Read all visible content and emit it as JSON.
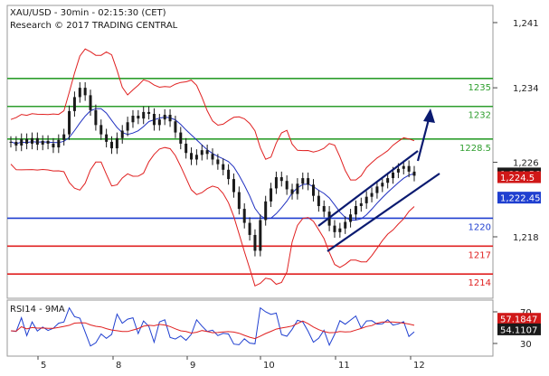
{
  "header": {
    "title": "XAU/USD - 30min - 02:15:30 (CET)",
    "source": "Research © 2017 TRADING CENTRAL"
  },
  "chart_data": {
    "type": "candlestick",
    "symbol": "XAU/USD",
    "timeframe": "30min",
    "price_ticks": [
      "1,241",
      "1,234",
      "1,226",
      "1,218"
    ],
    "price_tick_values": [
      1241,
      1234,
      1226,
      1218
    ],
    "x_ticks": [
      "5",
      "8",
      "9",
      "10",
      "11",
      "12"
    ],
    "levels": [
      {
        "label": "1235",
        "value": 1235,
        "color": "#2e9e2e"
      },
      {
        "label": "1232",
        "value": 1232,
        "color": "#2e9e2e"
      },
      {
        "label": "1228.5",
        "value": 1228.5,
        "color": "#2e9e2e"
      },
      {
        "label": "1220",
        "value": 1220,
        "color": "#1f3fd0"
      },
      {
        "label": "1217",
        "value": 1217,
        "color": "#e02020"
      },
      {
        "label": "1214",
        "value": 1214,
        "color": "#e02020"
      }
    ],
    "price_tags": [
      {
        "label": "1,224.56",
        "value": 1224.56,
        "color": "#1a1a1a"
      },
      {
        "label": "1,224.5",
        "value": 1224.5,
        "color": "#d01818"
      },
      {
        "label": "1,222.45",
        "value": 1222.45,
        "color": "#1f3fd0"
      }
    ],
    "close_series": [
      1228.2,
      1227.8,
      1228.5,
      1228.0,
      1228.6,
      1227.9,
      1228.3,
      1228.0,
      1227.6,
      1228.4,
      1229.0,
      1231.5,
      1233.0,
      1234.0,
      1233.2,
      1231.6,
      1230.0,
      1229.0,
      1228.2,
      1227.5,
      1228.6,
      1229.4,
      1230.3,
      1231.0,
      1230.7,
      1231.4,
      1231.2,
      1230.0,
      1230.6,
      1231.1,
      1230.4,
      1229.2,
      1228.0,
      1227.0,
      1226.3,
      1226.8,
      1227.3,
      1226.9,
      1226.3,
      1225.8,
      1225.2,
      1224.2,
      1222.8,
      1221.0,
      1219.5,
      1218.2,
      1216.5,
      1219.8,
      1221.8,
      1223.2,
      1224.4,
      1224.0,
      1223.1,
      1222.6,
      1223.7,
      1224.3,
      1223.6,
      1222.4,
      1221.3,
      1220.7,
      1219.2,
      1218.5,
      1218.9,
      1219.6,
      1220.4,
      1221.3,
      1221.6,
      1222.3,
      1222.7,
      1223.4,
      1223.8,
      1224.3,
      1224.9,
      1225.3,
      1225.6,
      1225.0,
      1224.56
    ],
    "rsi": {
      "name": "RSI14 - 9MA",
      "ticks": [
        "70",
        "30"
      ],
      "tick_values": [
        70,
        30
      ],
      "tags": [
        {
          "label": "57.1847",
          "value": 57.1847,
          "color": "#d01818"
        },
        {
          "label": "54.1107",
          "value": 54.1107,
          "color": "#1a1a1a"
        }
      ],
      "ylim": [
        20,
        80
      ]
    },
    "annotations": {
      "channel": "rising channel",
      "projection_arrow": "upward arrow toward 1232"
    },
    "colors": {
      "bollinger": "#e02020",
      "moving_average": "#2030c0",
      "candles": "#1a1a1a"
    }
  }
}
